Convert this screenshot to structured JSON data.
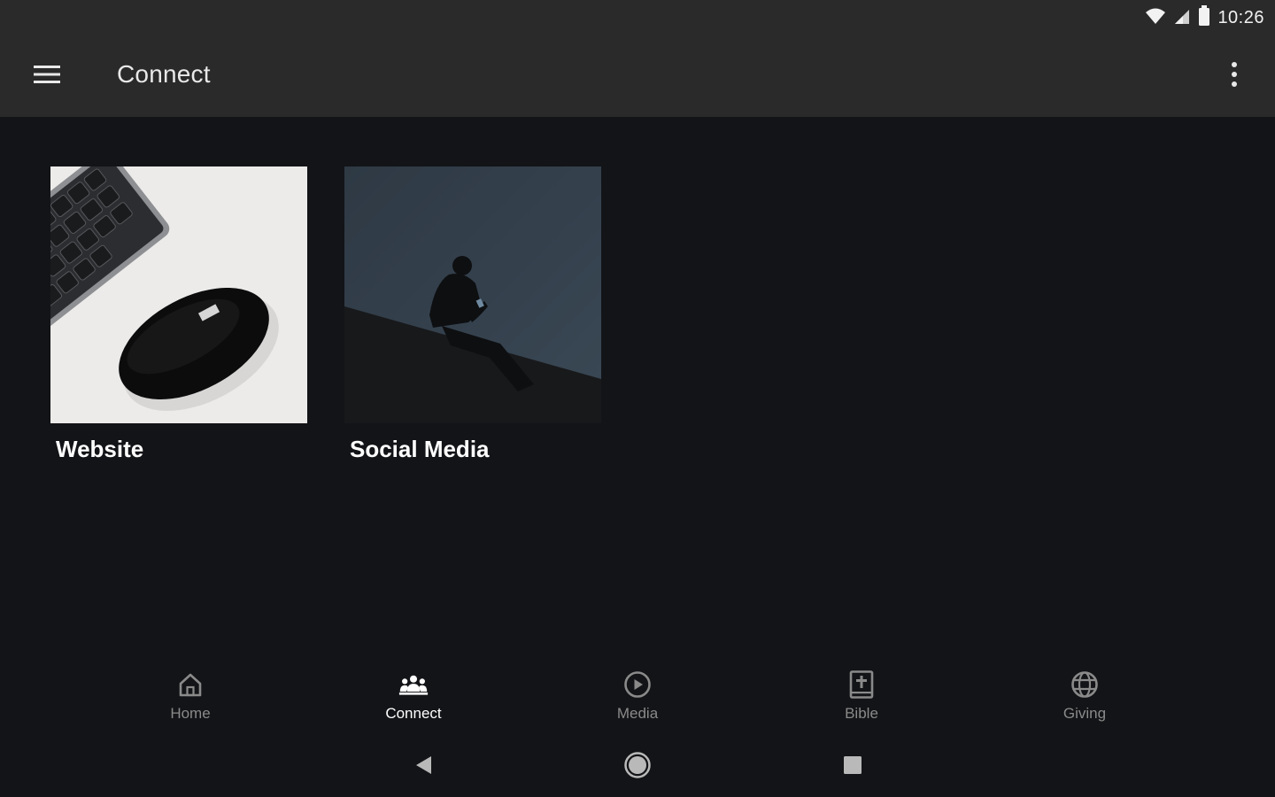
{
  "status_bar": {
    "time": "10:26",
    "icons": [
      "wifi-icon",
      "cell-signal-icon",
      "battery-icon"
    ]
  },
  "app_bar": {
    "title": "Connect",
    "menu_icon": "hamburger-menu-icon",
    "overflow_icon": "more-vert-icon"
  },
  "tiles": [
    {
      "label": "Website",
      "image": "keyboard-and-mouse-photo"
    },
    {
      "label": "Social Media",
      "image": "person-with-phone-photo"
    }
  ],
  "bottom_nav": {
    "items": [
      {
        "label": "Home",
        "icon": "home-icon",
        "active": false
      },
      {
        "label": "Connect",
        "icon": "people-icon",
        "active": true
      },
      {
        "label": "Media",
        "icon": "play-circle-icon",
        "active": false
      },
      {
        "label": "Bible",
        "icon": "bible-icon",
        "active": false
      },
      {
        "label": "Giving",
        "icon": "globe-icon",
        "active": false
      }
    ]
  },
  "system_nav": [
    "back-icon",
    "home-circle-icon",
    "recents-icon"
  ],
  "colors": {
    "background": "#131417",
    "app_bar": "#2a2a2a",
    "active_label": "#ffffff",
    "inactive_label": "#8a8a8a"
  }
}
